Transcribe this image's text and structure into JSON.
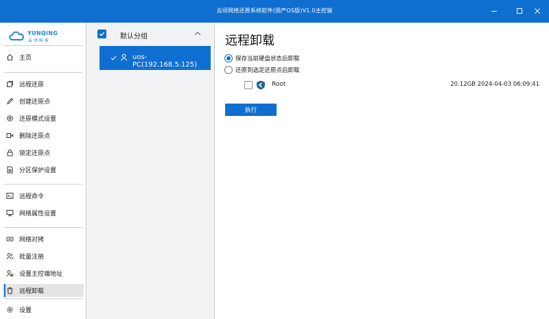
{
  "window": {
    "title": "云顷网络还原系统软件(国产OS版)V1.0主控端"
  },
  "logo": {
    "brand": "YUNQING",
    "sub": "云顷科技"
  },
  "sidebar": {
    "home": "主页",
    "items": [
      {
        "label": "远程还原",
        "icon": "remote-restore-icon"
      },
      {
        "label": "创建还原点",
        "icon": "create-restore-point-icon"
      },
      {
        "label": "还原模式设置",
        "icon": "restore-mode-icon"
      },
      {
        "label": "删除还原点",
        "icon": "delete-restore-point-icon"
      },
      {
        "label": "锁定还原点",
        "icon": "lock-icon"
      },
      {
        "label": "分区保护设置",
        "icon": "partition-protect-icon"
      },
      {
        "label": "远程命令",
        "icon": "terminal-icon"
      },
      {
        "label": "网络属性设置",
        "icon": "network-settings-icon"
      },
      {
        "label": "网络对拷",
        "icon": "network-copy-icon"
      },
      {
        "label": "批量注册",
        "icon": "batch-register-icon"
      },
      {
        "label": "设置主控端地址",
        "icon": "server-address-icon"
      },
      {
        "label": "远程卸载",
        "icon": "uninstall-icon"
      }
    ],
    "settings": "设置",
    "active": "远程卸载"
  },
  "groups": {
    "name": "默认分组",
    "host": "uos-PC(192.168.5.125)"
  },
  "main": {
    "title": "远程卸载",
    "option_keep": "保存当前硬盘状态后卸载",
    "option_restore": "还原到选定还原点后卸载",
    "selected_option": "保存当前硬盘状态后卸载",
    "disk": {
      "name": "Root",
      "info": "20.12GB 2024-04-03 06:09:41"
    },
    "execute": "执行"
  },
  "colors": {
    "accent": "#0f6fd0",
    "sidebar_active": "#e4e4e4",
    "group_panel": "#f1f2f3"
  }
}
